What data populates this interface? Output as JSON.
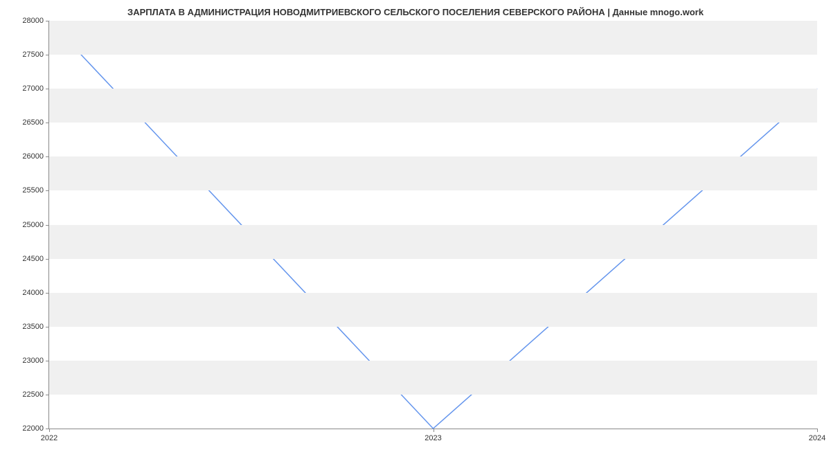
{
  "chart_data": {
    "type": "line",
    "title": "ЗАРПЛАТА В АДМИНИСТРАЦИЯ НОВОДМИТРИЕВСКОГО СЕЛЬСКОГО ПОСЕЛЕНИЯ СЕВЕРСКОГО РАЙОНА | Данные mnogo.work",
    "x": [
      2022,
      2023,
      2024
    ],
    "values": [
      28000,
      22000,
      27000
    ],
    "xlabel": "",
    "ylabel": "",
    "ylim": [
      22000,
      28000
    ],
    "xlim": [
      2022,
      2024
    ],
    "y_ticks": [
      22000,
      22500,
      23000,
      23500,
      24000,
      24500,
      25000,
      25500,
      26000,
      26500,
      27000,
      27500,
      28000
    ],
    "x_ticks": [
      2022,
      2023,
      2024
    ],
    "line_color": "#6495ed"
  }
}
